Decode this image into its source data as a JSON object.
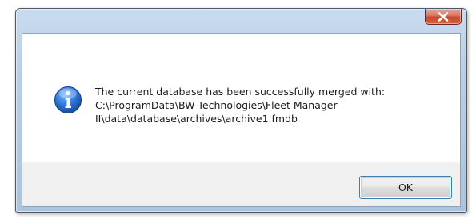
{
  "dialog": {
    "close_icon": "close-icon",
    "message_icon": "information-icon",
    "message": "The current database has been successfully merged with:\nC:\\ProgramData\\BW Technologies\\Fleet Manager\nII\\data\\database\\archives\\archive1.fmdb",
    "ok_label": "OK"
  },
  "colors": {
    "frame": "#b9cfe6",
    "close_button": "#c44a2f",
    "info_icon": "#1f67c9",
    "ok_focus": "#3c7fb1"
  }
}
